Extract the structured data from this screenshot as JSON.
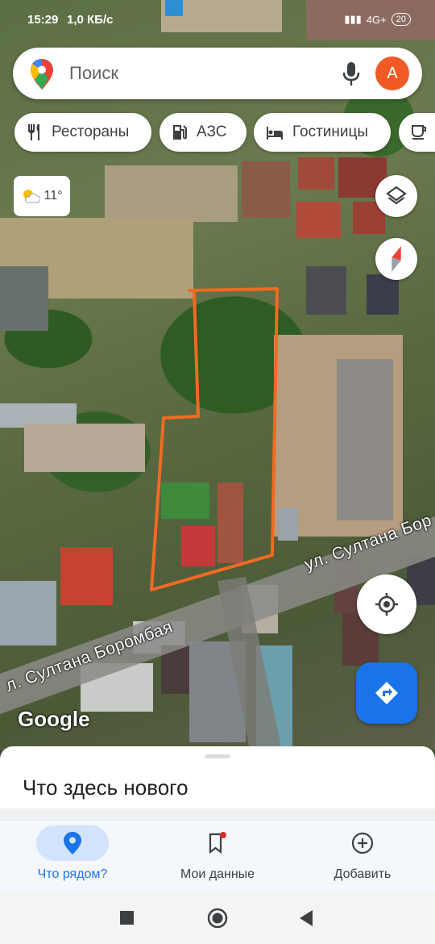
{
  "status_bar": {
    "time": "15:29",
    "speed": "1,0 КБ/с",
    "network": "4G+",
    "battery": "20"
  },
  "search": {
    "placeholder": "Поиск",
    "avatar_letter": "А"
  },
  "chips": [
    {
      "label": "Рестораны",
      "icon": "restaurant-icon"
    },
    {
      "label": "АЗС",
      "icon": "gas-station-icon"
    },
    {
      "label": "Гостиницы",
      "icon": "hotel-icon"
    },
    {
      "label": "",
      "icon": "coffee-icon"
    }
  ],
  "weather": {
    "temp": "11°",
    "icon": "partly-cloudy-icon"
  },
  "map": {
    "street_labels": [
      "ул. Султана Бор",
      "л. Султана Боромбая"
    ],
    "attribution": "Google",
    "outline_color": "#f26a22"
  },
  "sheet": {
    "title": "Что здесь нового"
  },
  "bottom_nav": [
    {
      "label": "Что рядом?",
      "icon": "explore-pin-icon",
      "active": true
    },
    {
      "label": "Мои данные",
      "icon": "saved-bookmark-icon",
      "active": false
    },
    {
      "label": "Добавить",
      "icon": "add-circle-icon",
      "active": false
    }
  ],
  "colors": {
    "accent": "#1a73e8",
    "avatar": "#f15a24",
    "outline": "#f26a22"
  }
}
